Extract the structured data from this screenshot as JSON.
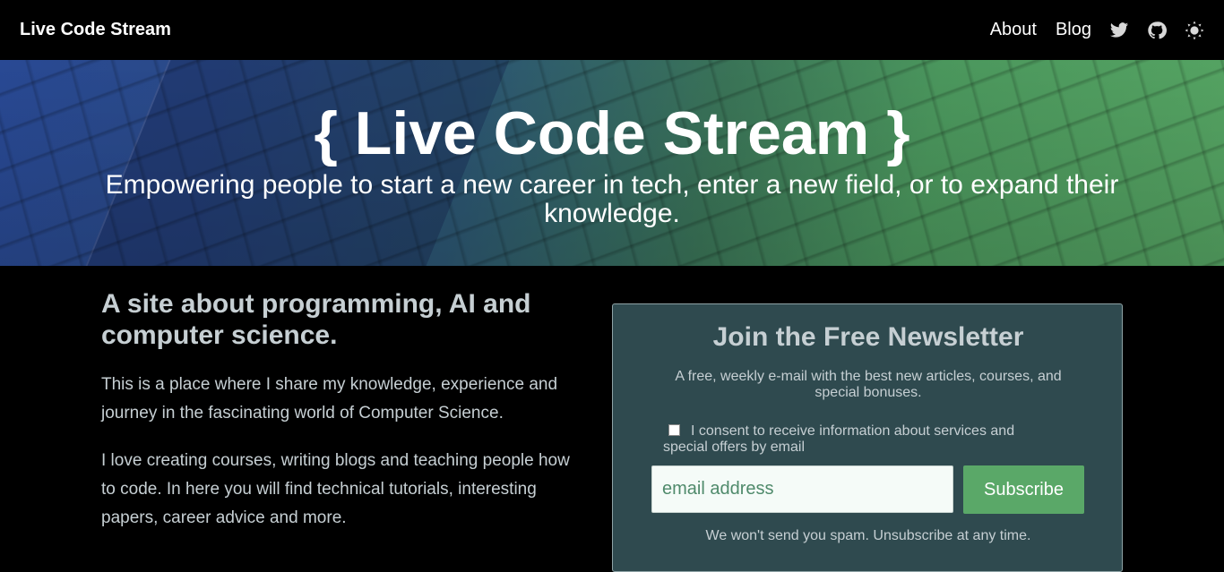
{
  "navbar": {
    "brand": "Live Code Stream",
    "links": [
      {
        "label": "About"
      },
      {
        "label": "Blog"
      }
    ],
    "icons": [
      "twitter-icon",
      "github-icon",
      "theme-toggle-icon"
    ]
  },
  "hero": {
    "title": "{ Live Code Stream }",
    "subtitle": "Empowering people to start a new career in tech, enter a new field, or to expand their knowledge."
  },
  "intro": {
    "headline": "A site about programming, AI and computer science.",
    "paragraphs": [
      "This is a place where I share my knowledge, experience and journey in the fascinating world of Computer Science.",
      "I love creating courses, writing blogs and teaching people how to code. In here you will find technical tutorials, interesting papers, career advice and more."
    ]
  },
  "newsletter": {
    "title": "Join the Free Newsletter",
    "description": "A free, weekly e-mail with the best new articles, courses, and special bonuses.",
    "consent_label": "I consent to receive information about services and special offers by email",
    "consent_checked": false,
    "email_placeholder": "email address",
    "email_value": "",
    "subscribe_label": "Subscribe",
    "footnote": "We won't send you spam. Unsubscribe at any time."
  },
  "colors": {
    "background": "#000000",
    "text_muted": "#c6cfd3",
    "newsletter_bg": "#2f4a4f",
    "accent_green": "#5aa868"
  }
}
